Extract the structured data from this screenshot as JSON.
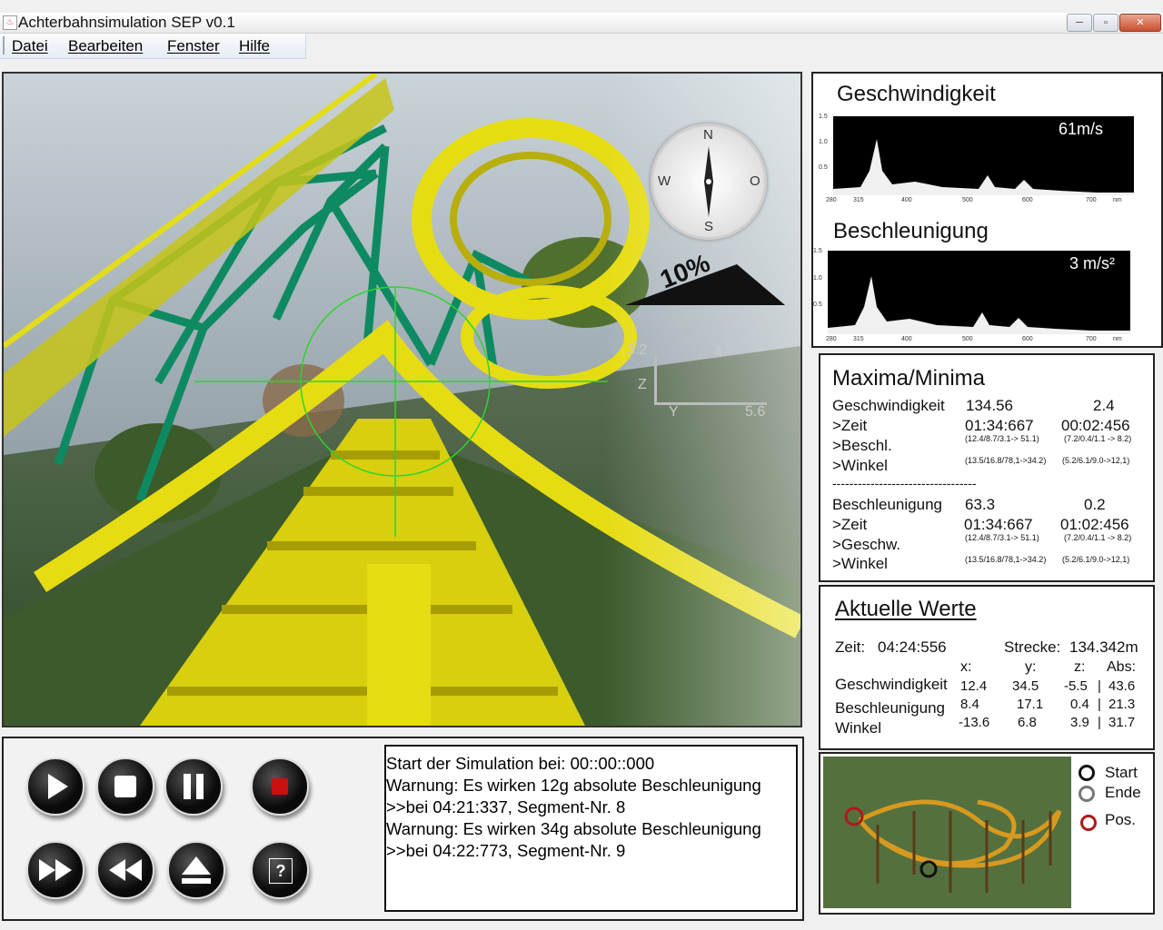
{
  "window": {
    "title": "Achterbahnsimulation SEP v0.1",
    "minimize": "─",
    "maximize": "▫",
    "close": "✕"
  },
  "menu": {
    "items": [
      "Datei",
      "Bearbeiten",
      "Fenster",
      "Hilfe"
    ]
  },
  "viewport": {
    "compass": {
      "n": "N",
      "s": "S",
      "w": "W",
      "o": "O"
    },
    "slope": "10%",
    "axes": {
      "z_label": "Z",
      "y_label": "Y",
      "z_value": "3.2",
      "diag_value": "4.5",
      "y_value": "5.6"
    }
  },
  "gauges": {
    "speed": {
      "title": "Geschwindigkeit",
      "value": "61m/s"
    },
    "accel": {
      "title": "Beschleunigung",
      "value": "3 m/s²"
    },
    "x_ticks": [
      "280",
      "315",
      "400",
      "500",
      "600",
      "700",
      "nm"
    ],
    "y_ticks": [
      "1.5",
      "1.0",
      "0.5"
    ]
  },
  "maxmin": {
    "title": "Maxima/Minima",
    "speed": {
      "label": "Geschwindigkeit",
      "max": "134.56",
      "min": "2.4"
    },
    "speed_time": {
      "label": ">Zeit",
      "max": "01:34:667",
      "min": "00:02:456"
    },
    "speed_accel": {
      "label": ">Beschl.",
      "max": "(12.4/8.7/3.1-> 51.1)",
      "min": "(7.2/0.4/1.1 -> 8.2)"
    },
    "speed_angle": {
      "label": ">Winkel",
      "max": "(13.5/16.8/78,1->34.2)",
      "min": "(5.2/6.1/9.0->12,1)"
    },
    "separator": "----------------------------------",
    "accel": {
      "label": "Beschleunigung",
      "max": "63.3",
      "min": "0.2"
    },
    "accel_time": {
      "label": ">Zeit",
      "max": "01:34:667",
      "min": "01:02:456"
    },
    "accel_speed": {
      "label": ">Geschw.",
      "max": "(12.4/8.7/3.1-> 51.1)",
      "min": "(7.2/0.4/1.1 -> 8.2)"
    },
    "accel_angle": {
      "label": ">Winkel",
      "max": "(13.5/16.8/78,1->34.2)",
      "min": "(5.2/6.1/9.0->12,1)"
    }
  },
  "current": {
    "title": "Aktuelle Werte",
    "time_label": "Zeit:",
    "time_value": "04:24:556",
    "distance_label": "Strecke:",
    "distance_value": "134.342m",
    "headers": {
      "x": "x:",
      "y": "y:",
      "z": "z:",
      "abs": "Abs:"
    },
    "rows": [
      {
        "label": "Geschwindigkeit",
        "x": "12.4",
        "y": "34.5",
        "z": "-5.5",
        "abs": "43.6"
      },
      {
        "label": "Beschleunigung",
        "x": "8.4",
        "y": "17.1",
        "z": "0.4",
        "abs": "21.3"
      },
      {
        "label": "Winkel",
        "x": "-13.6",
        "y": "6.8",
        "z": "3.9",
        "abs": "31.7"
      }
    ],
    "sep": "|"
  },
  "map": {
    "legend": {
      "start": "Start",
      "end": "Ende",
      "pos": "Pos."
    }
  },
  "controls": {
    "help": "?"
  },
  "log": {
    "lines": [
      "Start der Simulation bei: 00::00::000",
      "Warnung: Es wirken 12g absolute Beschleunigung",
      ">>bei 04:21:337, Segment-Nr. 8",
      "Warnung: Es wirken 34g absolute Beschleunigung",
      ">>bei 04:22:773, Segment-Nr. 9"
    ]
  },
  "colors": {
    "graph_bg": "#000000",
    "track": "#e6dc12",
    "tower": "#0e8a62",
    "grass": "#3c5a2c",
    "record": "#cc1010"
  }
}
